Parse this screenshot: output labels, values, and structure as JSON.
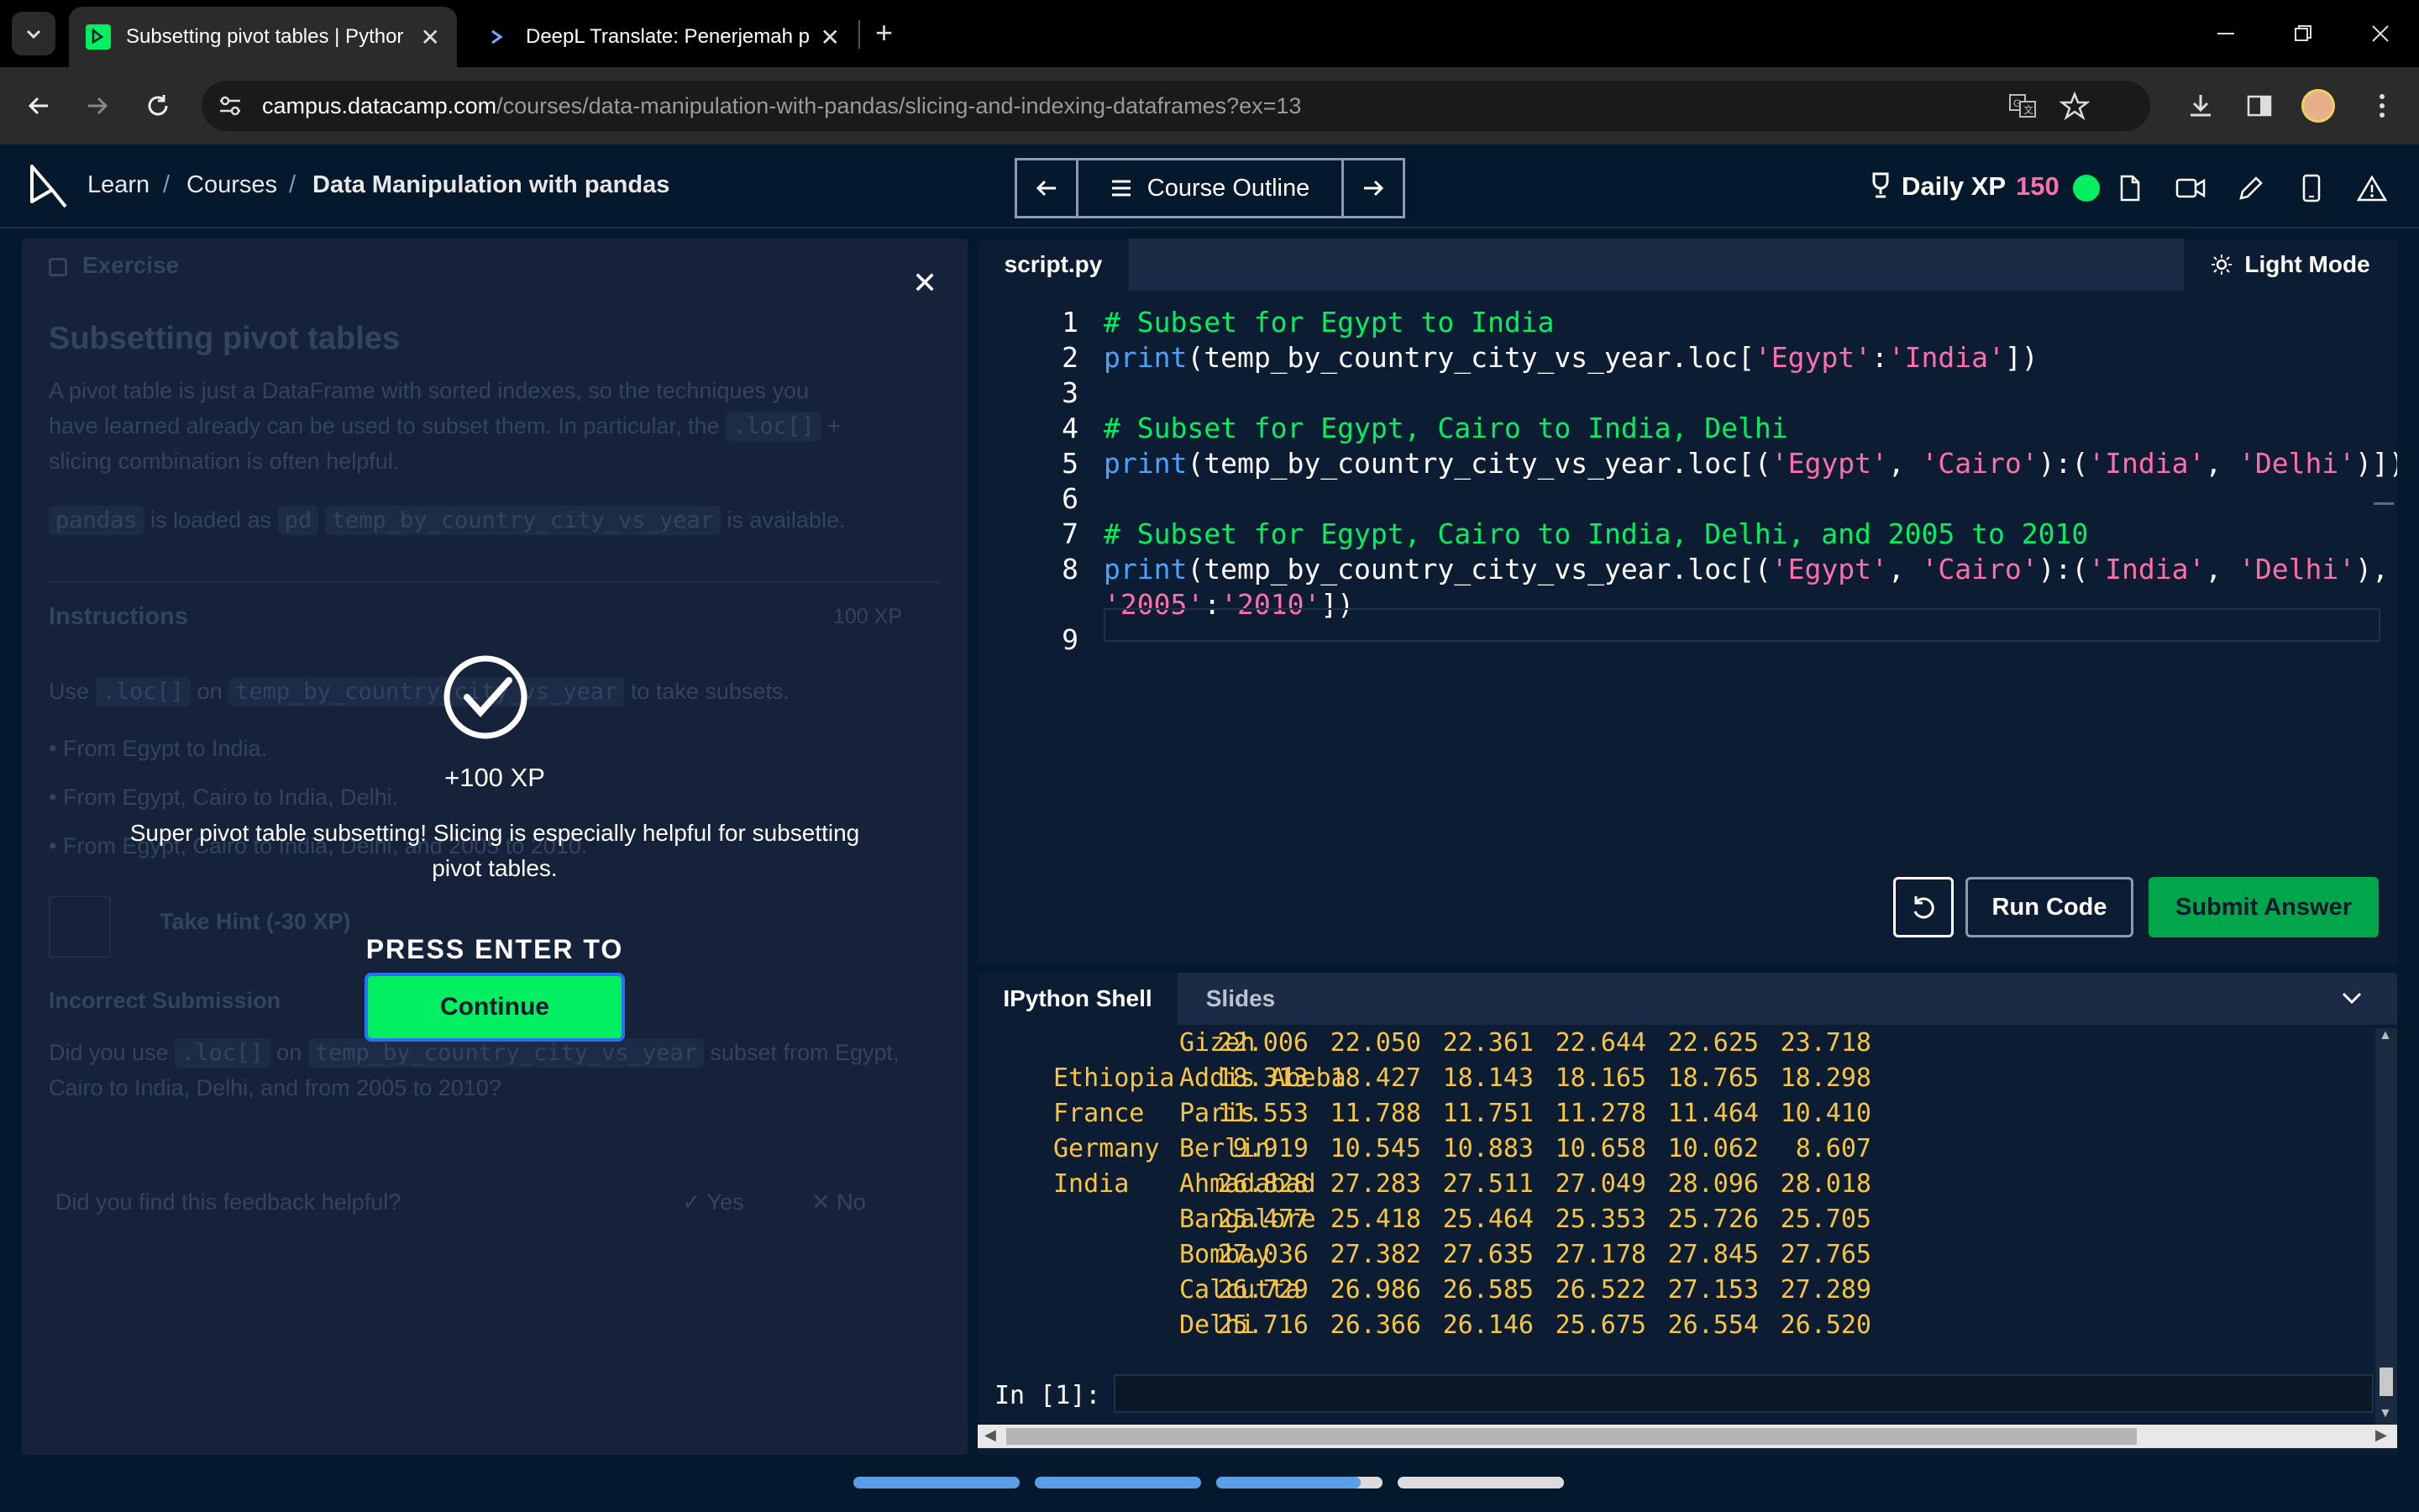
{
  "browser": {
    "tabs": [
      {
        "title": "Subsetting pivot tables | Pythor",
        "active": true
      },
      {
        "title": "DeepL Translate: Penerjemah pa",
        "active": false
      }
    ],
    "url_host": "campus.datacamp.com",
    "url_path": "/courses/data-manipulation-with-pandas/slicing-and-indexing-dataframes?ex=13"
  },
  "header": {
    "breadcrumb": [
      "Learn",
      "Courses",
      "Data Manipulation with pandas"
    ],
    "course_outline": "Course Outline",
    "daily_xp_label": "Daily XP",
    "daily_xp_value": "150",
    "colors": {
      "accent": "#03ef62",
      "xp": "#ff6ea9",
      "bg": "#05192d"
    }
  },
  "exercise": {
    "label": "Exercise",
    "title": "Subsetting pivot tables",
    "intro_1": "A pivot table is just a DataFrame with sorted indexes, so the techniques you",
    "intro_2": "have learned already can be used to subset them. In particular, the",
    "intro_code": ".loc[]",
    "intro_plus": "+",
    "intro_3": "slicing combination is often helpful.",
    "loaded_code1": "pandas",
    "loaded_text1": "is loaded as",
    "loaded_code2": "pd",
    "loaded_code3": "temp_by_country_city_vs_year",
    "loaded_text2": "is available.",
    "instructions_label": "Instructions",
    "instructions_xp": "100 XP",
    "use_text": "Use",
    "use_code1": ".loc[]",
    "use_on": "on",
    "use_code2": "temp_by_country_city_vs_year",
    "use_rest": "to take subsets.",
    "bullets": [
      "From Egypt to India.",
      "From Egypt, Cairo to India, Delhi.",
      "From Egypt, Cairo to India, Delhi, and 2005 to 2010."
    ],
    "hint": "Take Hint (-30 XP)",
    "incorrect_label": "Incorrect Submission",
    "incorrect_text1": "Did you use",
    "incorrect_code1": ".loc[]",
    "incorrect_on": "on",
    "incorrect_code2": "temp_by_country_city_vs_year",
    "incorrect_text2": "subset from Egypt,",
    "incorrect_text3": "Cairo to India, Delhi, and from 2005 to 2010?",
    "feedback_q": "Did you find this feedback helpful?",
    "yes": "Yes",
    "no": "No"
  },
  "modal": {
    "xp": "+100 XP",
    "msg_line1": "Super pivot table subsetting! Slicing is especially helpful for subsetting",
    "msg_line2": "pivot tables.",
    "press_enter": "PRESS ENTER TO",
    "continue": "Continue"
  },
  "editor": {
    "tab": "script.py",
    "light_mode": "Light Mode",
    "run": "Run Code",
    "submit": "Submit Answer",
    "line_numbers": [
      "1",
      "2",
      "3",
      "4",
      "5",
      "6",
      "7",
      "8",
      "9"
    ],
    "code": [
      [
        {
          "t": "# Subset for Egypt to India",
          "c": "cm"
        }
      ],
      [
        {
          "t": "print",
          "c": "kw"
        },
        {
          "t": "(temp_by_country_city_vs_year.loc[",
          "c": ""
        },
        {
          "t": "'Egypt'",
          "c": "st"
        },
        {
          "t": ":",
          "c": ""
        },
        {
          "t": "'India'",
          "c": "st"
        },
        {
          "t": "])",
          "c": ""
        }
      ],
      [],
      [
        {
          "t": "# Subset for Egypt, Cairo to India, Delhi",
          "c": "cm"
        }
      ],
      [
        {
          "t": "print",
          "c": "kw"
        },
        {
          "t": "(temp_by_country_city_vs_year.loc[(",
          "c": ""
        },
        {
          "t": "'Egypt'",
          "c": "st"
        },
        {
          "t": ", ",
          "c": ""
        },
        {
          "t": "'Cairo'",
          "c": "st"
        },
        {
          "t": "):(",
          "c": ""
        },
        {
          "t": "'India'",
          "c": "st"
        },
        {
          "t": ", ",
          "c": ""
        },
        {
          "t": "'Delhi'",
          "c": "st"
        },
        {
          "t": ")])",
          "c": ""
        }
      ],
      [],
      [
        {
          "t": "# Subset for Egypt, Cairo to India, Delhi, and 2005 to 2010",
          "c": "cm"
        }
      ],
      [
        {
          "t": "print",
          "c": "kw"
        },
        {
          "t": "(temp_by_country_city_vs_year.loc[(",
          "c": ""
        },
        {
          "t": "'Egypt'",
          "c": "st"
        },
        {
          "t": ", ",
          "c": ""
        },
        {
          "t": "'Cairo'",
          "c": "st"
        },
        {
          "t": "):(",
          "c": ""
        },
        {
          "t": "'India'",
          "c": "st"
        },
        {
          "t": ", ",
          "c": ""
        },
        {
          "t": "'Delhi'",
          "c": "st"
        },
        {
          "t": "),",
          "c": ""
        }
      ],
      [
        {
          "t": "'2005'",
          "c": "st"
        },
        {
          "t": ":",
          "c": ""
        },
        {
          "t": "'2010'",
          "c": "st"
        },
        {
          "t": "])",
          "c": ""
        }
      ]
    ]
  },
  "shell": {
    "tabs": [
      "IPython Shell",
      "Slides"
    ],
    "rows": [
      {
        "country": "",
        "city": "Gizeh",
        "vals": [
          "22.006",
          "22.050",
          "22.361",
          "22.644",
          "22.625",
          "23.718"
        ]
      },
      {
        "country": "Ethiopia",
        "city": "Addis Abeba",
        "vals": [
          "18.313",
          "18.427",
          "18.143",
          "18.165",
          "18.765",
          "18.298"
        ]
      },
      {
        "country": "France",
        "city": "Paris",
        "vals": [
          "11.553",
          "11.788",
          "11.751",
          "11.278",
          "11.464",
          "10.410"
        ]
      },
      {
        "country": "Germany",
        "city": "Berlin",
        "vals": [
          "9.919",
          "10.545",
          "10.883",
          "10.658",
          "10.062",
          "8.607"
        ]
      },
      {
        "country": "India",
        "city": "Ahmadabad",
        "vals": [
          "26.828",
          "27.283",
          "27.511",
          "27.049",
          "28.096",
          "28.018"
        ]
      },
      {
        "country": "",
        "city": "Bangalore",
        "vals": [
          "25.477",
          "25.418",
          "25.464",
          "25.353",
          "25.726",
          "25.705"
        ]
      },
      {
        "country": "",
        "city": "Bombay",
        "vals": [
          "27.036",
          "27.382",
          "27.635",
          "27.178",
          "27.845",
          "27.765"
        ]
      },
      {
        "country": "",
        "city": "Calcutta",
        "vals": [
          "26.729",
          "26.986",
          "26.585",
          "26.522",
          "27.153",
          "27.289"
        ]
      },
      {
        "country": "",
        "city": "Delhi",
        "vals": [
          "25.716",
          "26.366",
          "26.146",
          "25.675",
          "26.554",
          "26.520"
        ]
      }
    ],
    "prompt": "In [1]:"
  },
  "progress": {
    "segments_complete": 2,
    "current_fill": 0.87,
    "segments_total": 4
  }
}
